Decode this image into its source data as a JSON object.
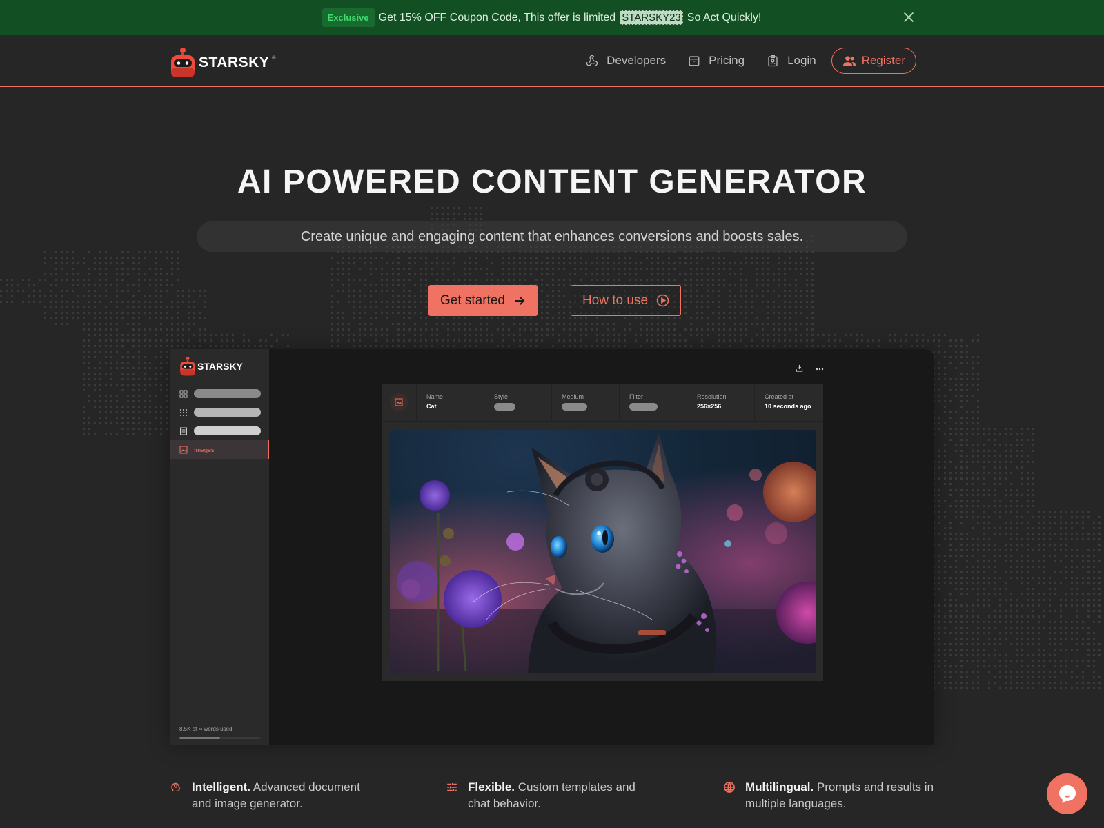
{
  "promo": {
    "badge": "Exclusive",
    "text_before": "Get 15% OFF Coupon Code, This offer is limited",
    "coupon_code": "STARSKY23",
    "text_after": "So Act Quickly!",
    "close_icon": "close-icon"
  },
  "header": {
    "brand": "STARSKY",
    "brand_mark": "®",
    "nav": [
      {
        "label": "Developers",
        "icon": "webhook-icon"
      },
      {
        "label": "Pricing",
        "icon": "package-icon"
      },
      {
        "label": "Login",
        "icon": "id-badge-icon"
      }
    ],
    "register": {
      "label": "Register",
      "icon": "users-icon"
    }
  },
  "hero": {
    "title": "AI POWERED CONTENT GENERATOR",
    "subtitle": "Create unique and engaging content that enhances conversions and boosts sales.",
    "primary_cta": "Get started",
    "secondary_cta": "How to use"
  },
  "mock_app": {
    "brand": "STARSKY",
    "sidebar": [
      {
        "icon": "grid-icon",
        "label": ""
      },
      {
        "icon": "apps-icon",
        "label": ""
      },
      {
        "icon": "document-icon",
        "label": ""
      },
      {
        "icon": "image-icon",
        "label": "Images",
        "active": true
      }
    ],
    "usage": "8.5K of ∞ words used.",
    "usage_fraction": 0.5,
    "toolbar": [
      "download-icon",
      "more-icon"
    ],
    "meta": [
      {
        "label": "Name",
        "value": "Cat"
      },
      {
        "label": "Style",
        "value": null
      },
      {
        "label": "Medium",
        "value": null
      },
      {
        "label": "Filter",
        "value": null
      },
      {
        "label": "Resolution",
        "value": "256×256"
      },
      {
        "label": "Created at",
        "value": "10 seconds ago"
      }
    ],
    "image_alt": "AI generated cat among flowers"
  },
  "features": [
    {
      "title": "Intelligent.",
      "text": "Advanced document and image generator.",
      "icon": "brain-icon"
    },
    {
      "title": "Flexible.",
      "text": "Custom templates and chat behavior.",
      "icon": "sliders-icon"
    },
    {
      "title": "Multilingual.",
      "text": "Prompts and results in multiple languages.",
      "icon": "globe-icon"
    }
  ],
  "colors": {
    "accent": "#f07262",
    "promo_bg": "#125024",
    "page_bg": "#262626"
  }
}
